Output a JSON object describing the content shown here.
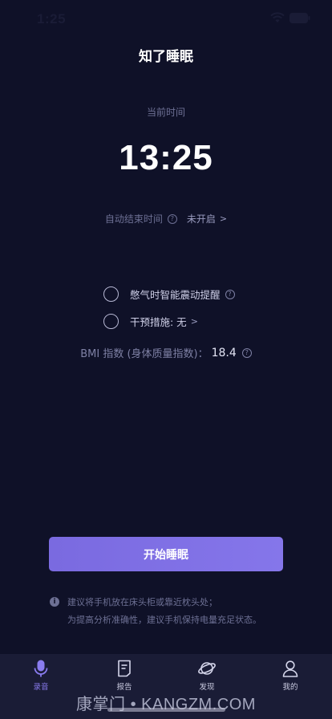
{
  "status_bar": {
    "time": "1:25"
  },
  "title": "知了睡眠",
  "current": {
    "label": "当前时间",
    "time": "13:25"
  },
  "auto_end": {
    "label": "自动结束时间",
    "value": "未开启"
  },
  "options": [
    {
      "label": "憋气时智能震动提醒",
      "checked": false
    },
    {
      "label": "干预措施: 无",
      "checked": false
    }
  ],
  "bmi": {
    "label": "BMI 指数 (身体质量指数)：",
    "value": "18.4"
  },
  "start_button": "开始睡眠",
  "tip": {
    "line1": "建议将手机放在床头柜或靠近枕头处；",
    "line2": "为提高分析准确性，建议手机保持电量充足状态。"
  },
  "tabs": [
    {
      "label": "录音",
      "icon": "microphone-icon",
      "active": true
    },
    {
      "label": "报告",
      "icon": "report-icon",
      "active": false
    },
    {
      "label": "发现",
      "icon": "planet-icon",
      "active": false
    },
    {
      "label": "我的",
      "icon": "person-icon",
      "active": false
    }
  ],
  "watermark": "康掌门 • KANGZM.COM",
  "colors": {
    "background": "#0f1128",
    "accent": "#7a6ae0",
    "tab_bar": "#1a1c36"
  }
}
